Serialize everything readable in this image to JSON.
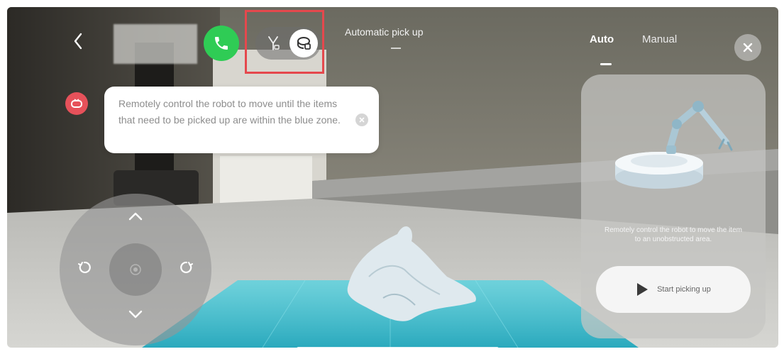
{
  "top_bar": {
    "back_icon": "chevron-left-icon",
    "call_icon": "phone-icon",
    "mode_toggle": {
      "manual_icon": "claw-icon",
      "auto_icon": "robot-scan-icon",
      "highlight_color": "#e5484d"
    },
    "status_label": "Automatic pick up"
  },
  "tabs": [
    {
      "label": "Auto",
      "active": true
    },
    {
      "label": "Manual",
      "active": false
    }
  ],
  "tooltip": {
    "text": "Remotely control the robot to move until the items that need to be picked up are within the blue zone.",
    "close_icon": "close-icon"
  },
  "joystick": {
    "up_icon": "chevron-up-icon",
    "down_icon": "chevron-down-icon",
    "rotate_left_icon": "rotate-ccw-icon",
    "rotate_right_icon": "rotate-cw-icon",
    "center_icon": "center-dot-icon"
  },
  "panel": {
    "description": "Remotely control the robot to move the item to an unobstructed area.",
    "start_button_label": "Start picking up",
    "start_icon": "play-icon"
  },
  "colors": {
    "call_green": "#2fcc55",
    "pickup_zone": "#3fc0d0",
    "accent_red": "#e6515a"
  }
}
